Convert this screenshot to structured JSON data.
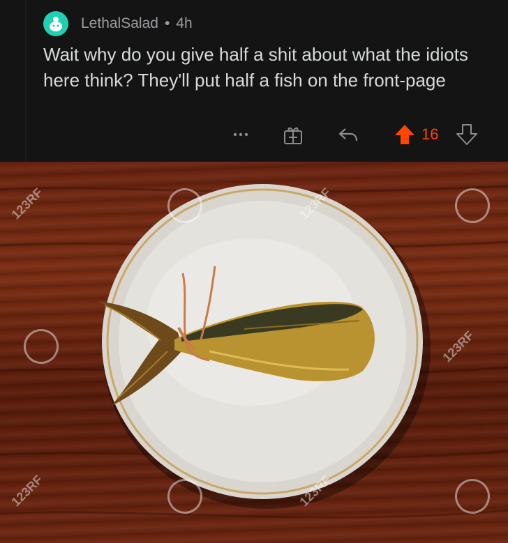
{
  "comment": {
    "username": "LethalSalad",
    "separator": "•",
    "time": "4h",
    "text": "Wait why do you give half a shit about what the idiots here think? They'll put half a fish on the front-page",
    "score": "16",
    "icons": [
      "avatar",
      "more-icon",
      "award-icon",
      "reply-icon",
      "upvote-icon",
      "downvote-icon"
    ],
    "colors": {
      "upvote": "#ff4500",
      "avatar": "#1fd1b2"
    }
  },
  "image": {
    "watermark": "123RF"
  }
}
